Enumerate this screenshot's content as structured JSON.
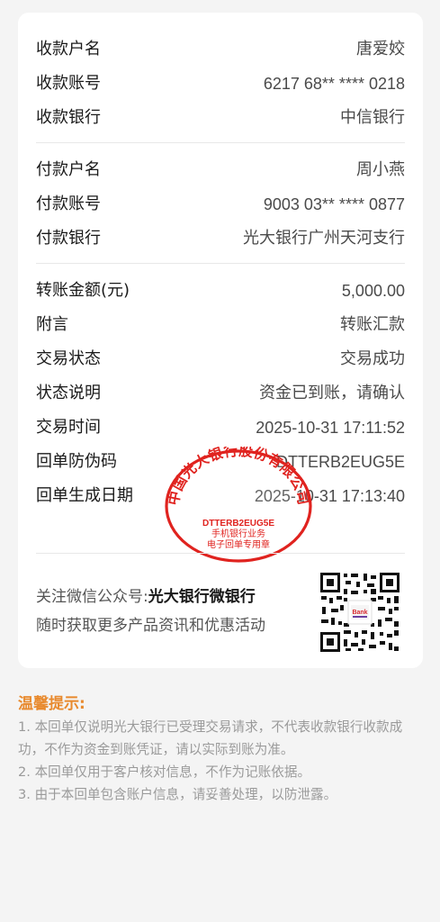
{
  "payee": {
    "name_label": "收款户名",
    "name_value": "唐爱姣",
    "account_label": "收款账号",
    "account_value": "6217 68** **** 0218",
    "bank_label": "收款银行",
    "bank_value": "中信银行"
  },
  "payer": {
    "name_label": "付款户名",
    "name_value": "周小燕",
    "account_label": "付款账号",
    "account_value": "9003 03** **** 0877",
    "bank_label": "付款银行",
    "bank_value": "光大银行广州天河支行"
  },
  "transaction": {
    "amount_label": "转账金额(元)",
    "amount_value": "5,000.00",
    "memo_label": "附言",
    "memo_value": "转账汇款",
    "status_label": "交易状态",
    "status_value": "交易成功",
    "status_desc_label": "状态说明",
    "status_desc_value": "资金已到账，请确认",
    "time_label": "交易时间",
    "time_value": "2025-10-31 17:11:52",
    "anti_fake_label": "回单防伪码",
    "anti_fake_value": "DTTERB2EUG5E",
    "receipt_date_label": "回单生成日期",
    "receipt_date_value": "2025-10-31 17:13:40"
  },
  "stamp": {
    "bank_name": "中国光大银行股份有限公司",
    "code": "DTTERB2EUG5E",
    "line1": "手机银行业务",
    "line2": "电子回单专用章"
  },
  "follow": {
    "prefix": "关注微信公众号:",
    "account_name": "光大银行微银行",
    "subtitle": "随时获取更多产品资讯和优惠活动",
    "qr_logo_text": "Bank"
  },
  "tips": {
    "title": "温馨提示:",
    "items": [
      "1. 本回单仅说明光大银行已受理交易请求，不代表收款银行收款成功，不作为资金到账凭证，请以实际到账为准。",
      "2. 本回单仅用于客户核对信息，不作为记账依据。",
      "3. 由于本回单包含账户信息，请妥善处理，以防泄露。"
    ]
  },
  "colors": {
    "accent_orange": "#e88a2e",
    "stamp_red": "#e0231f"
  }
}
